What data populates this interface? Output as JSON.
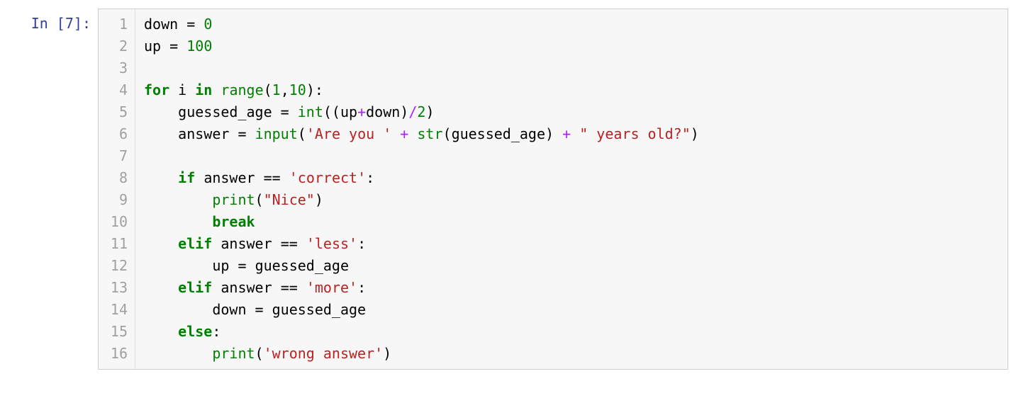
{
  "cell": {
    "prompt_prefix": "In [",
    "prompt_number": "7",
    "prompt_suffix": "]:",
    "line_numbers": [
      "1",
      "2",
      "3",
      "4",
      "5",
      "6",
      "7",
      "8",
      "9",
      "10",
      "11",
      "12",
      "13",
      "14",
      "15",
      "16"
    ],
    "code_plain": "down = 0\nup = 100\n\nfor i in range(1,10):\n    guessed_age = int((up+down)/2)\n    answer = input('Are you ' + str(guessed_age) + \" years old?\")\n\n    if answer == 'correct':\n        print(\"Nice\")\n        break\n    elif answer == 'less':\n        up = guessed_age\n    elif answer == 'more':\n        down = guessed_age\n    else:\n        print('wrong answer')",
    "lines": [
      [
        {
          "c": "n",
          "t": "down"
        },
        {
          "c": "p",
          "t": " "
        },
        {
          "c": "p",
          "t": "="
        },
        {
          "c": "p",
          "t": " "
        },
        {
          "c": "nm",
          "t": "0"
        }
      ],
      [
        {
          "c": "n",
          "t": "up"
        },
        {
          "c": "p",
          "t": " "
        },
        {
          "c": "p",
          "t": "="
        },
        {
          "c": "p",
          "t": " "
        },
        {
          "c": "nm",
          "t": "100"
        }
      ],
      [],
      [
        {
          "c": "k",
          "t": "for"
        },
        {
          "c": "p",
          "t": " "
        },
        {
          "c": "n",
          "t": "i"
        },
        {
          "c": "p",
          "t": " "
        },
        {
          "c": "k",
          "t": "in"
        },
        {
          "c": "p",
          "t": " "
        },
        {
          "c": "bi",
          "t": "range"
        },
        {
          "c": "p",
          "t": "("
        },
        {
          "c": "nm",
          "t": "1"
        },
        {
          "c": "p",
          "t": ","
        },
        {
          "c": "nm",
          "t": "10"
        },
        {
          "c": "p",
          "t": "):"
        }
      ],
      [
        {
          "c": "p",
          "t": "    "
        },
        {
          "c": "n",
          "t": "guessed_age"
        },
        {
          "c": "p",
          "t": " "
        },
        {
          "c": "p",
          "t": "="
        },
        {
          "c": "p",
          "t": " "
        },
        {
          "c": "bi",
          "t": "int"
        },
        {
          "c": "p",
          "t": "(("
        },
        {
          "c": "n",
          "t": "up"
        },
        {
          "c": "o",
          "t": "+"
        },
        {
          "c": "n",
          "t": "down"
        },
        {
          "c": "p",
          "t": ")"
        },
        {
          "c": "o",
          "t": "/"
        },
        {
          "c": "nm",
          "t": "2"
        },
        {
          "c": "p",
          "t": ")"
        }
      ],
      [
        {
          "c": "p",
          "t": "    "
        },
        {
          "c": "n",
          "t": "answer"
        },
        {
          "c": "p",
          "t": " "
        },
        {
          "c": "p",
          "t": "="
        },
        {
          "c": "p",
          "t": " "
        },
        {
          "c": "bi",
          "t": "input"
        },
        {
          "c": "p",
          "t": "("
        },
        {
          "c": "s",
          "t": "'Are you '"
        },
        {
          "c": "p",
          "t": " "
        },
        {
          "c": "o",
          "t": "+"
        },
        {
          "c": "p",
          "t": " "
        },
        {
          "c": "bi",
          "t": "str"
        },
        {
          "c": "p",
          "t": "("
        },
        {
          "c": "n",
          "t": "guessed_age"
        },
        {
          "c": "p",
          "t": ")"
        },
        {
          "c": "p",
          "t": " "
        },
        {
          "c": "o",
          "t": "+"
        },
        {
          "c": "p",
          "t": " "
        },
        {
          "c": "s",
          "t": "\" years old?\""
        },
        {
          "c": "p",
          "t": ")"
        }
      ],
      [],
      [
        {
          "c": "p",
          "t": "    "
        },
        {
          "c": "k",
          "t": "if"
        },
        {
          "c": "p",
          "t": " "
        },
        {
          "c": "n",
          "t": "answer"
        },
        {
          "c": "p",
          "t": " "
        },
        {
          "c": "p",
          "t": "=="
        },
        {
          "c": "p",
          "t": " "
        },
        {
          "c": "s",
          "t": "'correct'"
        },
        {
          "c": "p",
          "t": ":"
        }
      ],
      [
        {
          "c": "p",
          "t": "        "
        },
        {
          "c": "bi",
          "t": "print"
        },
        {
          "c": "p",
          "t": "("
        },
        {
          "c": "s",
          "t": "\"Nice\""
        },
        {
          "c": "p",
          "t": ")"
        }
      ],
      [
        {
          "c": "p",
          "t": "        "
        },
        {
          "c": "k",
          "t": "break"
        }
      ],
      [
        {
          "c": "p",
          "t": "    "
        },
        {
          "c": "k",
          "t": "elif"
        },
        {
          "c": "p",
          "t": " "
        },
        {
          "c": "n",
          "t": "answer"
        },
        {
          "c": "p",
          "t": " "
        },
        {
          "c": "p",
          "t": "=="
        },
        {
          "c": "p",
          "t": " "
        },
        {
          "c": "s",
          "t": "'less'"
        },
        {
          "c": "p",
          "t": ":"
        }
      ],
      [
        {
          "c": "p",
          "t": "        "
        },
        {
          "c": "n",
          "t": "up"
        },
        {
          "c": "p",
          "t": " "
        },
        {
          "c": "p",
          "t": "="
        },
        {
          "c": "p",
          "t": " "
        },
        {
          "c": "n",
          "t": "guessed_age"
        }
      ],
      [
        {
          "c": "p",
          "t": "    "
        },
        {
          "c": "k",
          "t": "elif"
        },
        {
          "c": "p",
          "t": " "
        },
        {
          "c": "n",
          "t": "answer"
        },
        {
          "c": "p",
          "t": " "
        },
        {
          "c": "p",
          "t": "=="
        },
        {
          "c": "p",
          "t": " "
        },
        {
          "c": "s",
          "t": "'more'"
        },
        {
          "c": "p",
          "t": ":"
        }
      ],
      [
        {
          "c": "p",
          "t": "        "
        },
        {
          "c": "n",
          "t": "down"
        },
        {
          "c": "p",
          "t": " "
        },
        {
          "c": "p",
          "t": "="
        },
        {
          "c": "p",
          "t": " "
        },
        {
          "c": "n",
          "t": "guessed_age"
        }
      ],
      [
        {
          "c": "p",
          "t": "    "
        },
        {
          "c": "k",
          "t": "else"
        },
        {
          "c": "p",
          "t": ":"
        }
      ],
      [
        {
          "c": "p",
          "t": "        "
        },
        {
          "c": "bi",
          "t": "print"
        },
        {
          "c": "p",
          "t": "("
        },
        {
          "c": "s",
          "t": "'wrong answer'"
        },
        {
          "c": "p",
          "t": ")"
        }
      ]
    ]
  }
}
